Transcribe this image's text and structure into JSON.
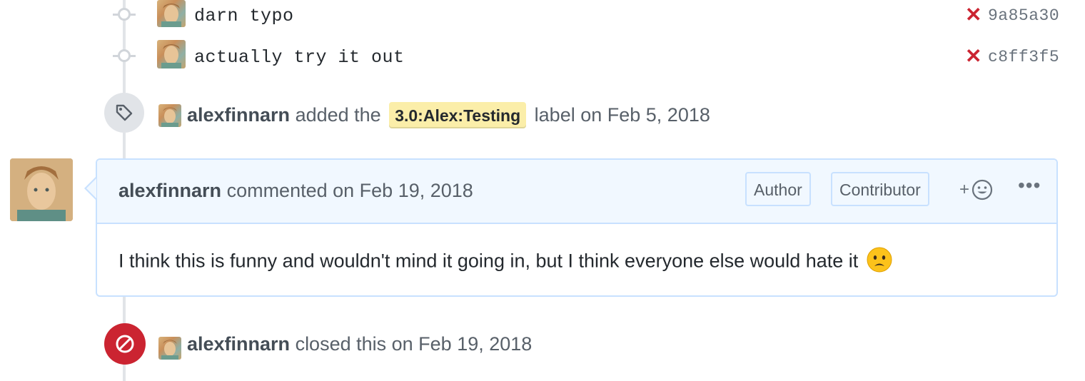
{
  "commits": [
    {
      "message": "darn typo",
      "sha": "9a85a30",
      "status_icon": "x-icon"
    },
    {
      "message": "actually try it out",
      "sha": "c8ff3f5",
      "status_icon": "x-icon"
    }
  ],
  "label_event": {
    "user": "alexfinnarn",
    "text_before": "added the",
    "label": "3.0:Alex:Testing",
    "text_after": "label on Feb 5, 2018",
    "label_color": "#fbeea9",
    "icon": "tag-icon"
  },
  "comment": {
    "user": "alexfinnarn",
    "action": "commented on Feb 19, 2018",
    "badges": [
      "Author",
      "Contributor"
    ],
    "reaction_glyph": "+",
    "more_glyph": "•••",
    "body": "I think this is funny and wouldn't mind it going in, but I think everyone else would hate it",
    "emoji": "😦"
  },
  "close_event": {
    "user": "alexfinnarn",
    "text": "closed this on Feb 19, 2018",
    "icon": "circle-slash-icon",
    "color": "#cb2431"
  },
  "colors": {
    "error": "#cb2431",
    "header_bg": "#f1f8ff",
    "border": "#c8e1ff"
  }
}
